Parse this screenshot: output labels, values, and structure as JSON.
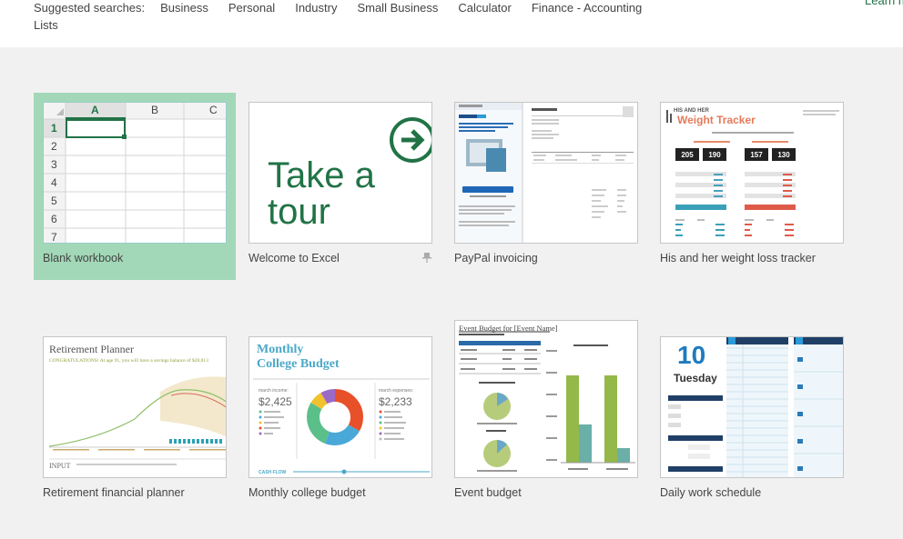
{
  "header": {
    "suggested_label": "Suggested searches:",
    "suggestions": [
      "Business",
      "Personal",
      "Industry",
      "Small Business",
      "Calculator",
      "Finance - Accounting"
    ],
    "lists_label": "Lists",
    "learn_more": "Learn more"
  },
  "templates": [
    {
      "caption": "Blank workbook",
      "selected": true
    },
    {
      "caption": "Welcome to Excel",
      "thumb_text_1": "Take a",
      "thumb_text_2": "tour"
    },
    {
      "caption": "PayPal invoicing"
    },
    {
      "caption": "His and her weight loss tracker",
      "thumb_small": "HIS AND HER",
      "thumb_title": "Weight Tracker"
    },
    {
      "caption": "Retirement financial planner",
      "thumb_title": "Retirement Planner",
      "thumb_congrats": "CONGRATULATIONS! At age 91, you will have a savings balance of $28,813",
      "thumb_input": "INPUT"
    },
    {
      "caption": "Monthly college budget",
      "thumb_title_1": "Monthly",
      "thumb_title_2": "College Budget",
      "income_label": "march income:",
      "income_value": "$2,425",
      "expense_label": "march expenses:",
      "expense_value": "$2,233",
      "flow_label": "CASH FLOW"
    },
    {
      "caption": "Event budget",
      "thumb_title": "Event Budget for [Event Name]"
    },
    {
      "caption": "Daily work schedule",
      "thumb_day_num": "10",
      "thumb_day_name": "Tuesday"
    }
  ],
  "grid": {
    "columns": [
      "A",
      "B",
      "C"
    ],
    "rows": [
      "1",
      "2",
      "3",
      "4",
      "5",
      "6",
      "7"
    ]
  },
  "colors": {
    "excel_green": "#217346",
    "selected_tile": "#a2d8b8",
    "background": "#f1f1f1"
  }
}
